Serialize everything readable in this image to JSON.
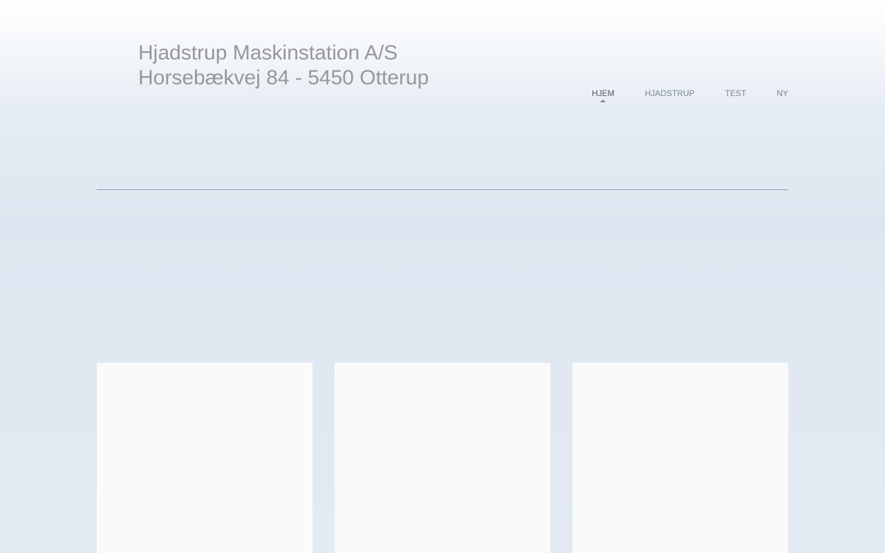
{
  "header": {
    "title_line1": "Hjadstrup Maskinstation A/S",
    "title_line2": "Horsebækvej 84 - 5450 Otterup"
  },
  "nav": {
    "items": [
      {
        "label": "HJEM",
        "active": true
      },
      {
        "label": "HJADSTRUP",
        "active": false
      },
      {
        "label": "TEST",
        "active": false
      },
      {
        "label": "NY",
        "active": false
      }
    ]
  },
  "colors": {
    "title_text": "#979797",
    "nav_text": "#7a8798",
    "nav_active_text": "#4e5662",
    "divider": "#8d9bb1",
    "card_background": "#fafafa"
  }
}
